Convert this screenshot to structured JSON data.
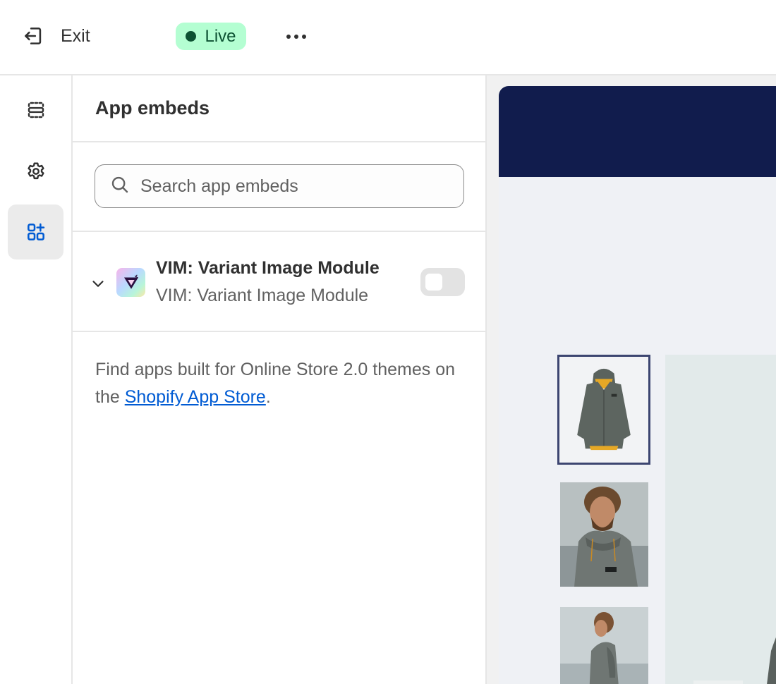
{
  "topbar": {
    "exit_label": "Exit",
    "status_label": "Live",
    "status_color": "#b4fed2",
    "status_dot_color": "#0c5132",
    "more_icon": "more-horizontal-icon"
  },
  "rail": {
    "items": [
      {
        "icon": "sections-icon",
        "active": false
      },
      {
        "icon": "gear-icon",
        "active": false
      },
      {
        "icon": "app-embeds-icon",
        "active": true
      }
    ]
  },
  "panel": {
    "title": "App embeds",
    "search": {
      "placeholder": "Search app embeds",
      "value": ""
    },
    "embeds": [
      {
        "title": "VIM: Variant Image Module",
        "subtitle": "VIM: Variant Image Module",
        "enabled": false
      }
    ],
    "help": {
      "text_before": "Find apps built for Online Store 2.0 themes on the ",
      "link_label": "Shopify App Store",
      "text_after": "."
    }
  },
  "preview": {
    "banner_color": "#111c4d",
    "link_color": "#005bd3"
  }
}
